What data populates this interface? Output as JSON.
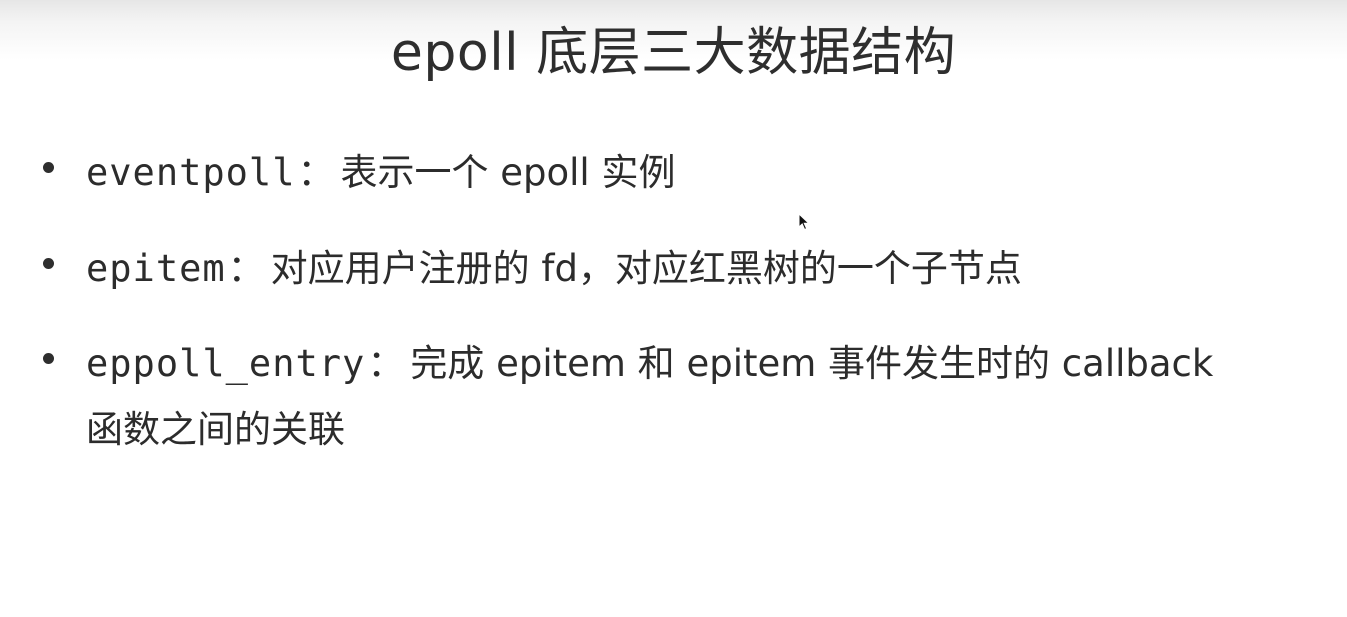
{
  "slide": {
    "title": "epoll 底层三大数据结构",
    "bullets": [
      {
        "term": "eventpoll",
        "separator": "：",
        "description": "表示一个 epoll 实例",
        "description_continued": ""
      },
      {
        "term": "epitem",
        "separator": "：",
        "description": "对应用户注册的 fd，对应红黑树的一个子节点",
        "description_continued": ""
      },
      {
        "term": "eppoll_entry",
        "separator": "：",
        "description": "完成 epitem 和 epitem 事件发生时的 callback",
        "description_continued": "函数之间的关联"
      }
    ]
  },
  "colors": {
    "text": "#2c2c2c",
    "background": "#ffffff",
    "top_shade": "#e6e6e6"
  },
  "icons": {
    "cursor": "mouse-pointer-icon"
  }
}
